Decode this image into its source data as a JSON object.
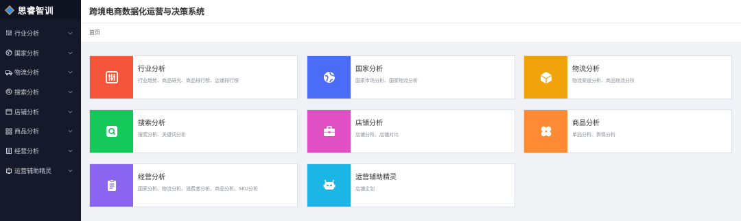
{
  "brand": {
    "name": "思睿智训"
  },
  "header": {
    "title": "跨境电商数据化运营与决策系统"
  },
  "breadcrumb": {
    "home": "首页"
  },
  "sidebar": {
    "items": [
      {
        "label": "行业分析",
        "icon": "sliders-icon"
      },
      {
        "label": "国家分析",
        "icon": "globe-icon"
      },
      {
        "label": "物流分析",
        "icon": "truck-icon"
      },
      {
        "label": "搜索分析",
        "icon": "search-icon"
      },
      {
        "label": "店铺分析",
        "icon": "shop-icon"
      },
      {
        "label": "商品分析",
        "icon": "grid-icon"
      },
      {
        "label": "经营分析",
        "icon": "clipboard-icon"
      },
      {
        "label": "运营辅助精灵",
        "icon": "robot-icon"
      }
    ]
  },
  "cards": [
    {
      "title": "行业分析",
      "desc": "行业趋势、商品研究、商品排行榜、店铺排行榜",
      "color": "#f4553b",
      "icon": "sliders-icon"
    },
    {
      "title": "国家分析",
      "desc": "国家市场分析、国家物流分析",
      "color": "#4a6cf7",
      "icon": "globe-icon"
    },
    {
      "title": "物流分析",
      "desc": "物流渠道分析、商品物流分析",
      "color": "#f0a30a",
      "icon": "cube-icon"
    },
    {
      "title": "搜索分析",
      "desc": "搜索分析、关键词分析",
      "color": "#14c95a",
      "icon": "search-icon"
    },
    {
      "title": "店铺分析",
      "desc": "店铺分析、店铺对比",
      "color": "#e04fc4",
      "icon": "briefcase-icon"
    },
    {
      "title": "商品分析",
      "desc": "单品分析、舆情分析",
      "color": "#ff8a34",
      "icon": "clover-icon"
    },
    {
      "title": "经营分析",
      "desc": "国家分析、物流分析、消费者分析、商品分析、SKU分析",
      "color": "#8a66f0",
      "icon": "clipboard-icon"
    },
    {
      "title": "运营辅助精灵",
      "desc": "店铺企划",
      "color": "#1bb5e6",
      "icon": "robot-icon"
    }
  ]
}
